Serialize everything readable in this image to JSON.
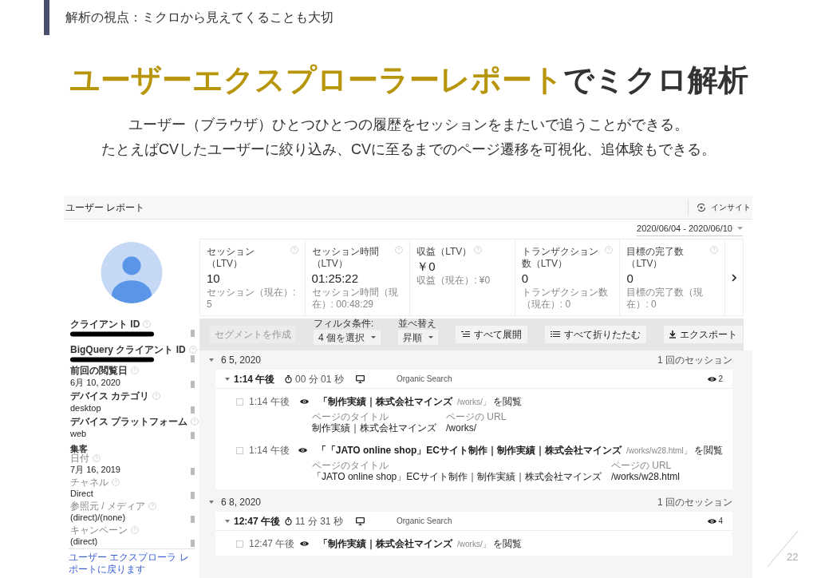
{
  "header": {
    "section": "解析の視点：ミクロから見えてくることも大切"
  },
  "title": {
    "highlight": "ユーザーエクスプローラーレポート",
    "rest": "でミクロ解析"
  },
  "description": [
    "ユーザー（ブラウザ）ひとつひとつの履歴をセッションをまたいで追うことができる。",
    "たとえばCVしたユーザーに絞り込み、CVに至るまでのページ遷移を可視化、追体験もできる。"
  ],
  "report": {
    "title": "ユーザー レポート",
    "insight": "インサイト",
    "date_range": "2020/06/04 - 2020/06/10",
    "user_fields": [
      {
        "kind": "field",
        "label": "クライアント ID",
        "redacted": true
      },
      {
        "kind": "field",
        "label": "BigQuery クライアント ID",
        "redacted": true
      },
      {
        "kind": "field",
        "label": "前回の閲覧日",
        "value": "6月 10, 2020",
        "redacted": false
      },
      {
        "kind": "field",
        "label": "デバイス カテゴリ",
        "value": "desktop",
        "redacted": false
      },
      {
        "kind": "field",
        "label": "デバイス プラットフォーム",
        "value": "web",
        "redacted": false
      },
      {
        "kind": "group",
        "label": "集客",
        "children": [
          {
            "label": "日付",
            "value": "7月 16, 2019"
          },
          {
            "label": "チャネル",
            "value": "Direct"
          },
          {
            "label": "参照元 / メディア",
            "value": "(direct)/(none)"
          },
          {
            "label": "キャンペーン",
            "value": "(direct)"
          }
        ]
      }
    ],
    "back_link": "ユーザー エクスプローラ レポートに戻ります",
    "metrics": [
      {
        "label": "セッション（LTV）",
        "value": "10",
        "sub": "セッション（現在）: 5"
      },
      {
        "label": "セッション時間（LTV）",
        "value": "01:25:22",
        "sub": "セッション時間（現在）: 00:48:29"
      },
      {
        "label": "収益（LTV）",
        "value": "￥0",
        "sub": "収益（現在）: ¥0"
      },
      {
        "label": "トランザクション数（LTV）",
        "value": "0",
        "sub": "トランザクション数（現在）: 0"
      },
      {
        "label": "目標の完了数（LTV）",
        "value": "0",
        "sub": "目標の完了数（現在）: 0"
      }
    ],
    "toolbar": {
      "segment_button": {
        "label": "セグメントを作成",
        "disabled": true
      },
      "filter": {
        "label": "フィルタ条件:",
        "value": "4 個を選択"
      },
      "sort": {
        "label": "並べ替え",
        "value": "昇順"
      },
      "buttons": [
        {
          "label": "すべて展開"
        },
        {
          "label": "すべて折りたたむ"
        },
        {
          "label": "エクスポート"
        }
      ]
    },
    "days": [
      {
        "date": "6 5, 2020",
        "expanded": true,
        "sessions": "1 回のセッション",
        "visits": [
          {
            "time": "1:14 午後",
            "expanded": true,
            "duration": "00 分 01 秒",
            "source": "Organic Search",
            "views": "2",
            "hits": [
              {
                "checked": false,
                "time": "1:14 午後",
                "title": "「制作実績｜株式会社マインズ",
                "path": "/works/」",
                "action": "を閲覧",
                "title_label": "ページのタイトル",
                "title_value": "制作実績｜株式会社マインズ",
                "url_label": "ページの URL",
                "url_value": "/works/"
              },
              {
                "checked": false,
                "time": "1:14 午後",
                "title": "「「JATO online shop」ECサイト制作｜制作実績｜株式会社マインズ",
                "path": "/works/w28.html」",
                "action": "を閲覧",
                "title_label": "ページのタイトル",
                "title_value": "「JATO online shop」ECサイト制作｜制作実績｜株式会社マインズ",
                "url_label": "ページの URL",
                "url_value": "/works/w28.html"
              }
            ]
          }
        ]
      },
      {
        "date": "6 8, 2020",
        "expanded": true,
        "sessions": "1 回のセッション",
        "visits": [
          {
            "time": "12:47 午後",
            "expanded": true,
            "duration": "11 分 31 秒",
            "source": "Organic Search",
            "views": "4",
            "hits": [
              {
                "checked": false,
                "time": "12:47 午後",
                "title": "「制作実績｜株式会社マインズ",
                "path": "/works/」",
                "action": "を閲覧"
              }
            ]
          }
        ]
      }
    ]
  },
  "page_number": "22"
}
